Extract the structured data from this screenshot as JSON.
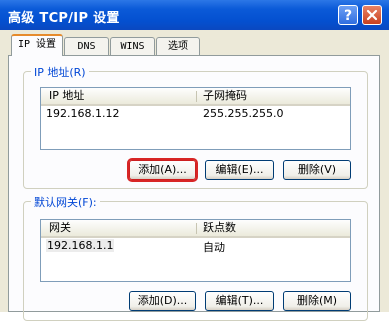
{
  "window": {
    "title": "高级 TCP/IP 设置",
    "help_label": "?"
  },
  "tabs": [
    {
      "label": "IP 设置",
      "active": true
    },
    {
      "label": "DNS",
      "active": false
    },
    {
      "label": "WINS",
      "active": false
    },
    {
      "label": "选项",
      "active": false
    }
  ],
  "ip_group": {
    "legend": "IP 地址(R)",
    "columns": [
      "IP 地址",
      "子网掩码"
    ],
    "rows": [
      {
        "ip": "192.168.1.12",
        "mask": "255.255.255.0"
      }
    ],
    "buttons": {
      "add": "添加(A)...",
      "edit": "编辑(E)...",
      "delete": "删除(V)"
    }
  },
  "gateway_group": {
    "legend": "默认网关(F):",
    "columns": [
      "网关",
      "跃点数"
    ],
    "rows": [
      {
        "gateway": "192.168.1.1",
        "metric": "自动"
      }
    ],
    "buttons": {
      "add": "添加(D)...",
      "edit": "编辑(T)...",
      "delete": "删除(M)"
    }
  }
}
